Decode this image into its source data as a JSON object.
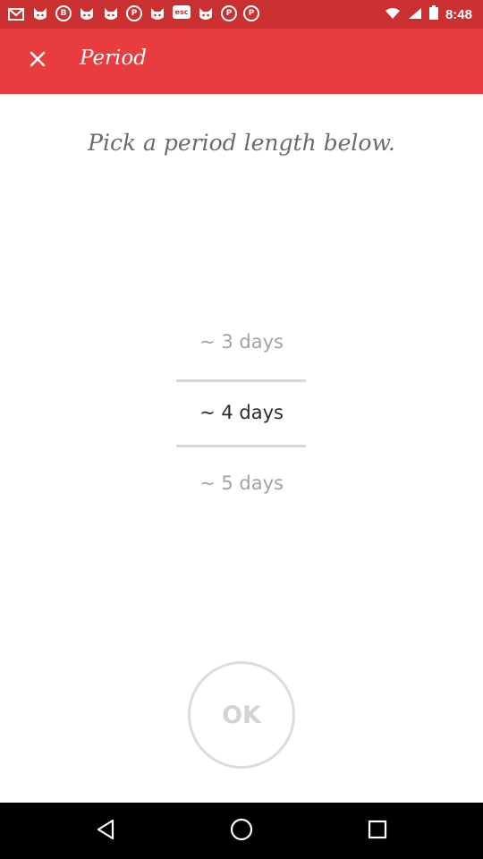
{
  "status_bar": {
    "time": "8:48",
    "notification_icons": [
      "mail-icon",
      "cat-icon",
      "b-icon",
      "cat-icon",
      "cat-icon",
      "pinterest-icon",
      "cat-icon",
      "esc-icon",
      "cat-icon",
      "pinterest-icon",
      "pinterest-icon"
    ],
    "esc_text": "esc",
    "b_text": "B",
    "p_text": "P"
  },
  "app_bar": {
    "title": "Period",
    "close_icon": "close-icon",
    "background_color": "#e83c3f"
  },
  "main": {
    "instruction": "Pick a period length below.",
    "picker": {
      "options": [
        {
          "label": "~ 3 days",
          "selected": false
        },
        {
          "label": "~ 4 days",
          "selected": true
        },
        {
          "label": "~ 5 days",
          "selected": false
        }
      ]
    },
    "ok_label": "OK"
  },
  "nav_bar": {
    "back_icon": "back-icon",
    "home_icon": "home-icon",
    "recents_icon": "recents-icon"
  }
}
